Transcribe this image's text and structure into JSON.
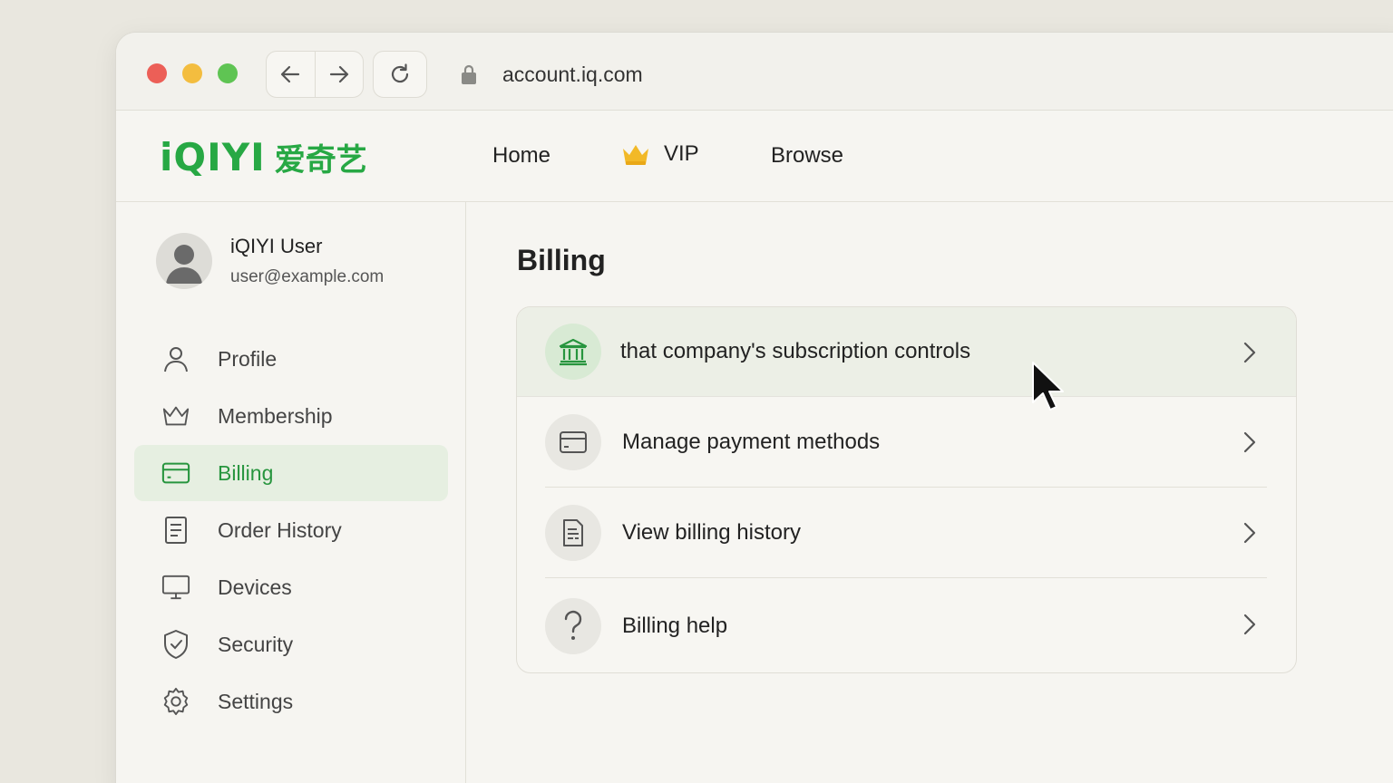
{
  "browser": {
    "url": "account.iq.com"
  },
  "brand": {
    "logo_text": "iQIYI",
    "logo_cn": "爱奇艺",
    "accent": "#27a844"
  },
  "topnav": {
    "home": "Home",
    "vip": "VIP",
    "browse": "Browse"
  },
  "user": {
    "name": "iQIYI User",
    "email": "user@example.com"
  },
  "sidebar": {
    "items": [
      {
        "label": "Profile",
        "icon": "person-icon"
      },
      {
        "label": "Membership",
        "icon": "crown-icon"
      },
      {
        "label": "Billing",
        "icon": "card-icon",
        "active": true
      },
      {
        "label": "Order History",
        "icon": "document-icon"
      },
      {
        "label": "Devices",
        "icon": "monitor-icon"
      },
      {
        "label": "Security",
        "icon": "shield-icon"
      },
      {
        "label": "Settings",
        "icon": "gear-icon"
      }
    ]
  },
  "main": {
    "title": "Billing",
    "options": [
      {
        "label": "that company's subscription controls",
        "icon": "bank-icon"
      },
      {
        "label": "Manage payment methods",
        "icon": "card-icon"
      },
      {
        "label": "View billing history",
        "icon": "receipt-icon"
      },
      {
        "label": "Billing help",
        "icon": "question-icon"
      }
    ]
  }
}
